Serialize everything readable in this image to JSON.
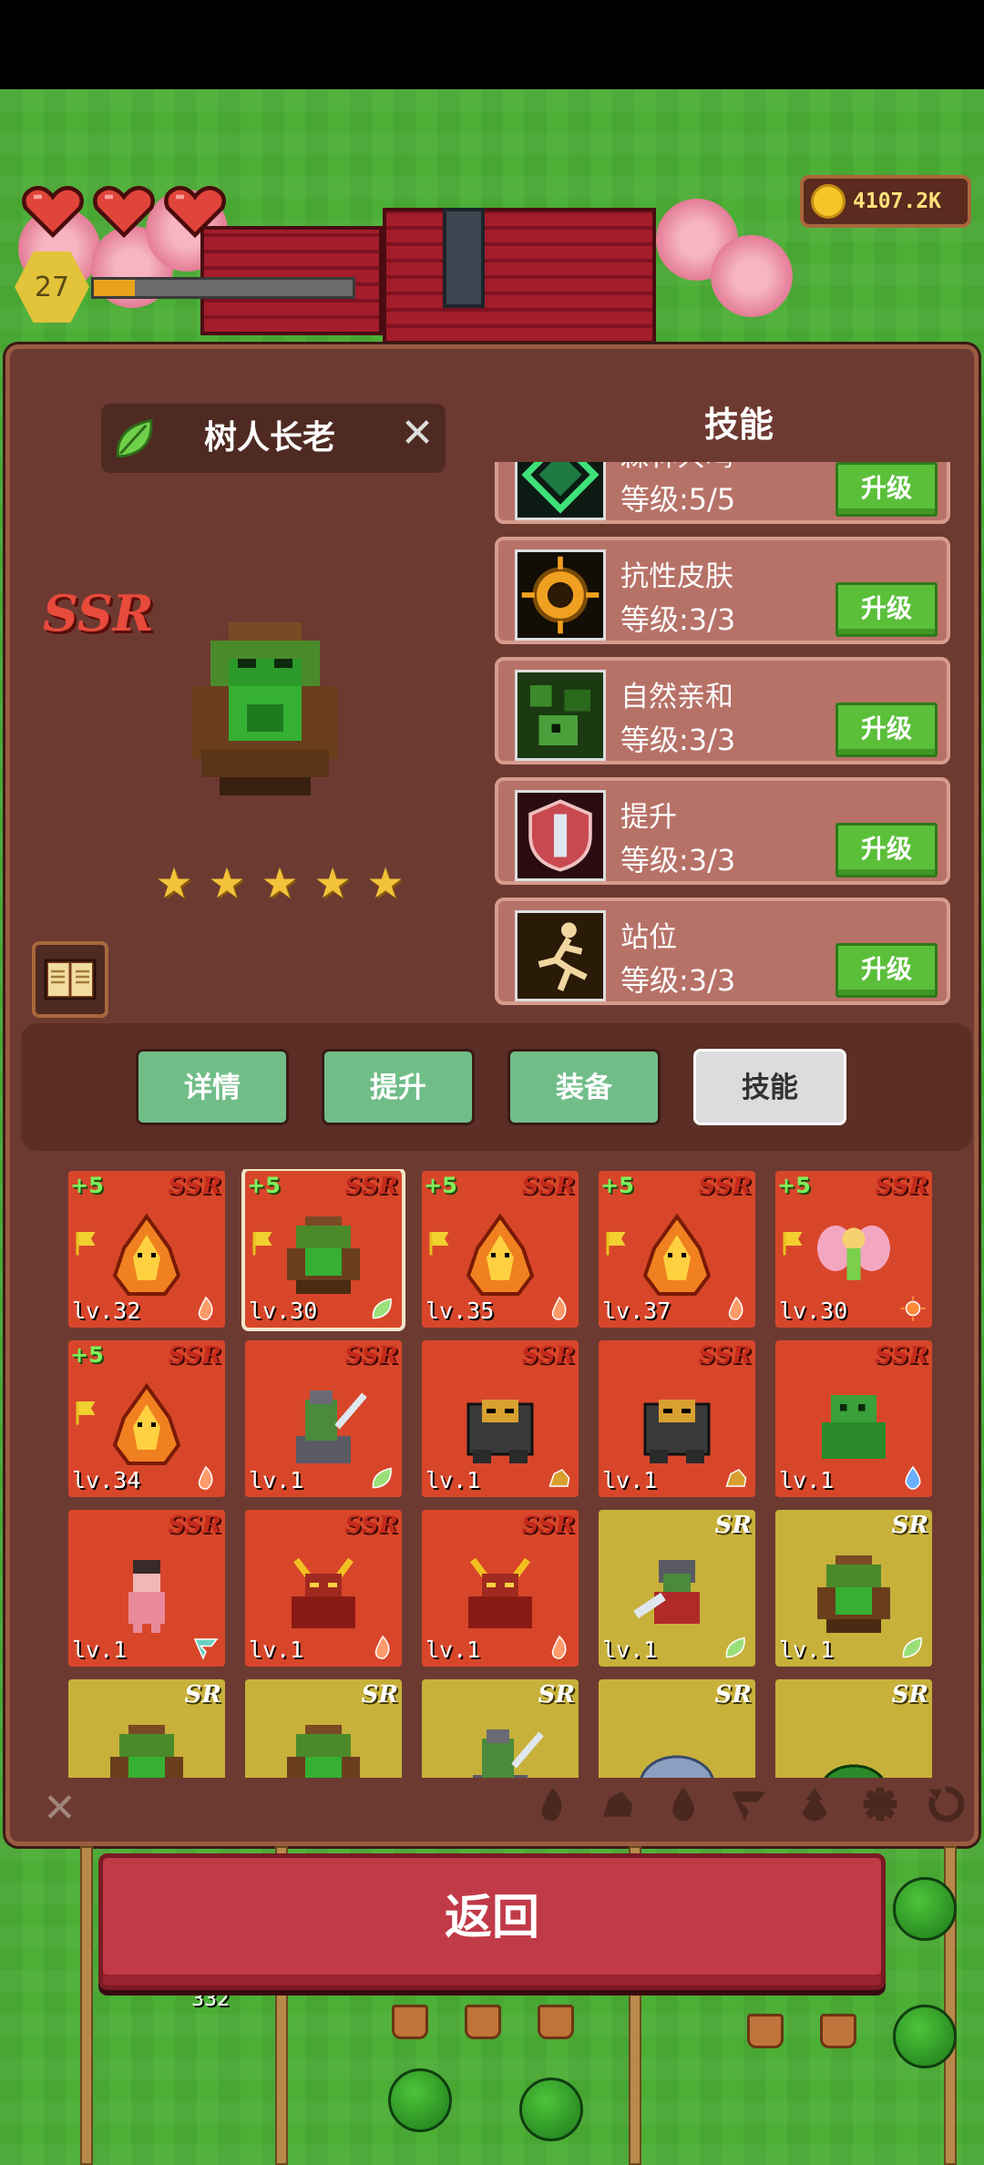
{
  "hud": {
    "hearts": 3,
    "player_level": "27",
    "xp_progress": 0.16,
    "coins": "4107.2K"
  },
  "hero": {
    "name": "树人长老",
    "rarity": "SSR",
    "stars": 5
  },
  "skills": {
    "title": "技能",
    "upgrade_label": "升级",
    "items": [
      {
        "name": "森林共鸣",
        "level": "等级:5/5"
      },
      {
        "name": "抗性皮肤",
        "level": "等级:3/3"
      },
      {
        "name": "自然亲和",
        "level": "等级:3/3"
      },
      {
        "name": "提升",
        "level": "等级:3/3"
      },
      {
        "name": "站位",
        "level": "等级:3/3"
      }
    ]
  },
  "tabs": [
    {
      "label": "详情",
      "active": false
    },
    {
      "label": "提升",
      "active": false
    },
    {
      "label": "装备",
      "active": false
    },
    {
      "label": "技能",
      "active": true
    }
  ],
  "roster": [
    {
      "plus": "+5",
      "rarity": "SSR",
      "level": "lv.32",
      "unit": "fire-elemental",
      "element": "fire",
      "flag": true
    },
    {
      "plus": "+5",
      "rarity": "SSR",
      "level": "lv.30",
      "unit": "treant",
      "element": "leaf",
      "flag": true,
      "selected": true
    },
    {
      "plus": "+5",
      "rarity": "SSR",
      "level": "lv.35",
      "unit": "fire-elemental",
      "element": "fire",
      "flag": true
    },
    {
      "plus": "+5",
      "rarity": "SSR",
      "level": "lv.37",
      "unit": "fire-elemental",
      "element": "fire",
      "flag": true
    },
    {
      "plus": "+5",
      "rarity": "SSR",
      "level": "lv.30",
      "unit": "fairy",
      "element": "sun",
      "flag": true
    },
    {
      "plus": "+5",
      "rarity": "SSR",
      "level": "lv.34",
      "unit": "fire-elemental",
      "element": "fire",
      "flag": true
    },
    {
      "plus": "",
      "rarity": "SSR",
      "level": "lv.1",
      "unit": "orc-rider",
      "element": "leaf",
      "flag": false
    },
    {
      "plus": "",
      "rarity": "SSR",
      "level": "lv.1",
      "unit": "rock-golem",
      "element": "rock",
      "flag": false
    },
    {
      "plus": "",
      "rarity": "SSR",
      "level": "lv.1",
      "unit": "rock-golem",
      "element": "rock",
      "flag": false
    },
    {
      "plus": "",
      "rarity": "SSR",
      "level": "lv.1",
      "unit": "slime-golem",
      "element": "water",
      "flag": false
    },
    {
      "plus": "",
      "rarity": "SSR",
      "level": "lv.1",
      "unit": "pink-imp",
      "element": "wind",
      "flag": false
    },
    {
      "plus": "",
      "rarity": "SSR",
      "level": "lv.1",
      "unit": "fire-demon",
      "element": "fire",
      "flag": false
    },
    {
      "plus": "",
      "rarity": "SSR",
      "level": "lv.1",
      "unit": "fire-demon",
      "element": "fire",
      "flag": false
    },
    {
      "plus": "",
      "rarity": "SR",
      "level": "lv.1",
      "unit": "orc-knight",
      "element": "leaf",
      "flag": false
    },
    {
      "plus": "",
      "rarity": "SR",
      "level": "lv.1",
      "unit": "treant",
      "element": "leaf",
      "flag": false
    },
    {
      "plus": "",
      "rarity": "SR",
      "level": "",
      "unit": "treant",
      "element": "",
      "flag": false
    },
    {
      "plus": "",
      "rarity": "SR",
      "level": "",
      "unit": "treant",
      "element": "",
      "flag": false
    },
    {
      "plus": "",
      "rarity": "SR",
      "level": "",
      "unit": "orc-rider",
      "element": "",
      "flag": false
    },
    {
      "plus": "",
      "rarity": "SR",
      "level": "",
      "unit": "blue-blob",
      "element": "",
      "flag": false
    },
    {
      "plus": "",
      "rarity": "SR",
      "level": "",
      "unit": "green-blob",
      "element": "",
      "flag": false
    }
  ],
  "filters": [
    "fire",
    "rock",
    "water",
    "wind",
    "flame",
    "gear",
    "cycle"
  ],
  "return_label": "返回",
  "farm": {
    "soldier_count": "332"
  },
  "colors": {
    "ssr_card": "#d8462a",
    "sr_card": "#c7b13a",
    "upgrade_green": "#5bbf3a",
    "tab_green": "#71bd88",
    "return_red": "#c13a48"
  }
}
